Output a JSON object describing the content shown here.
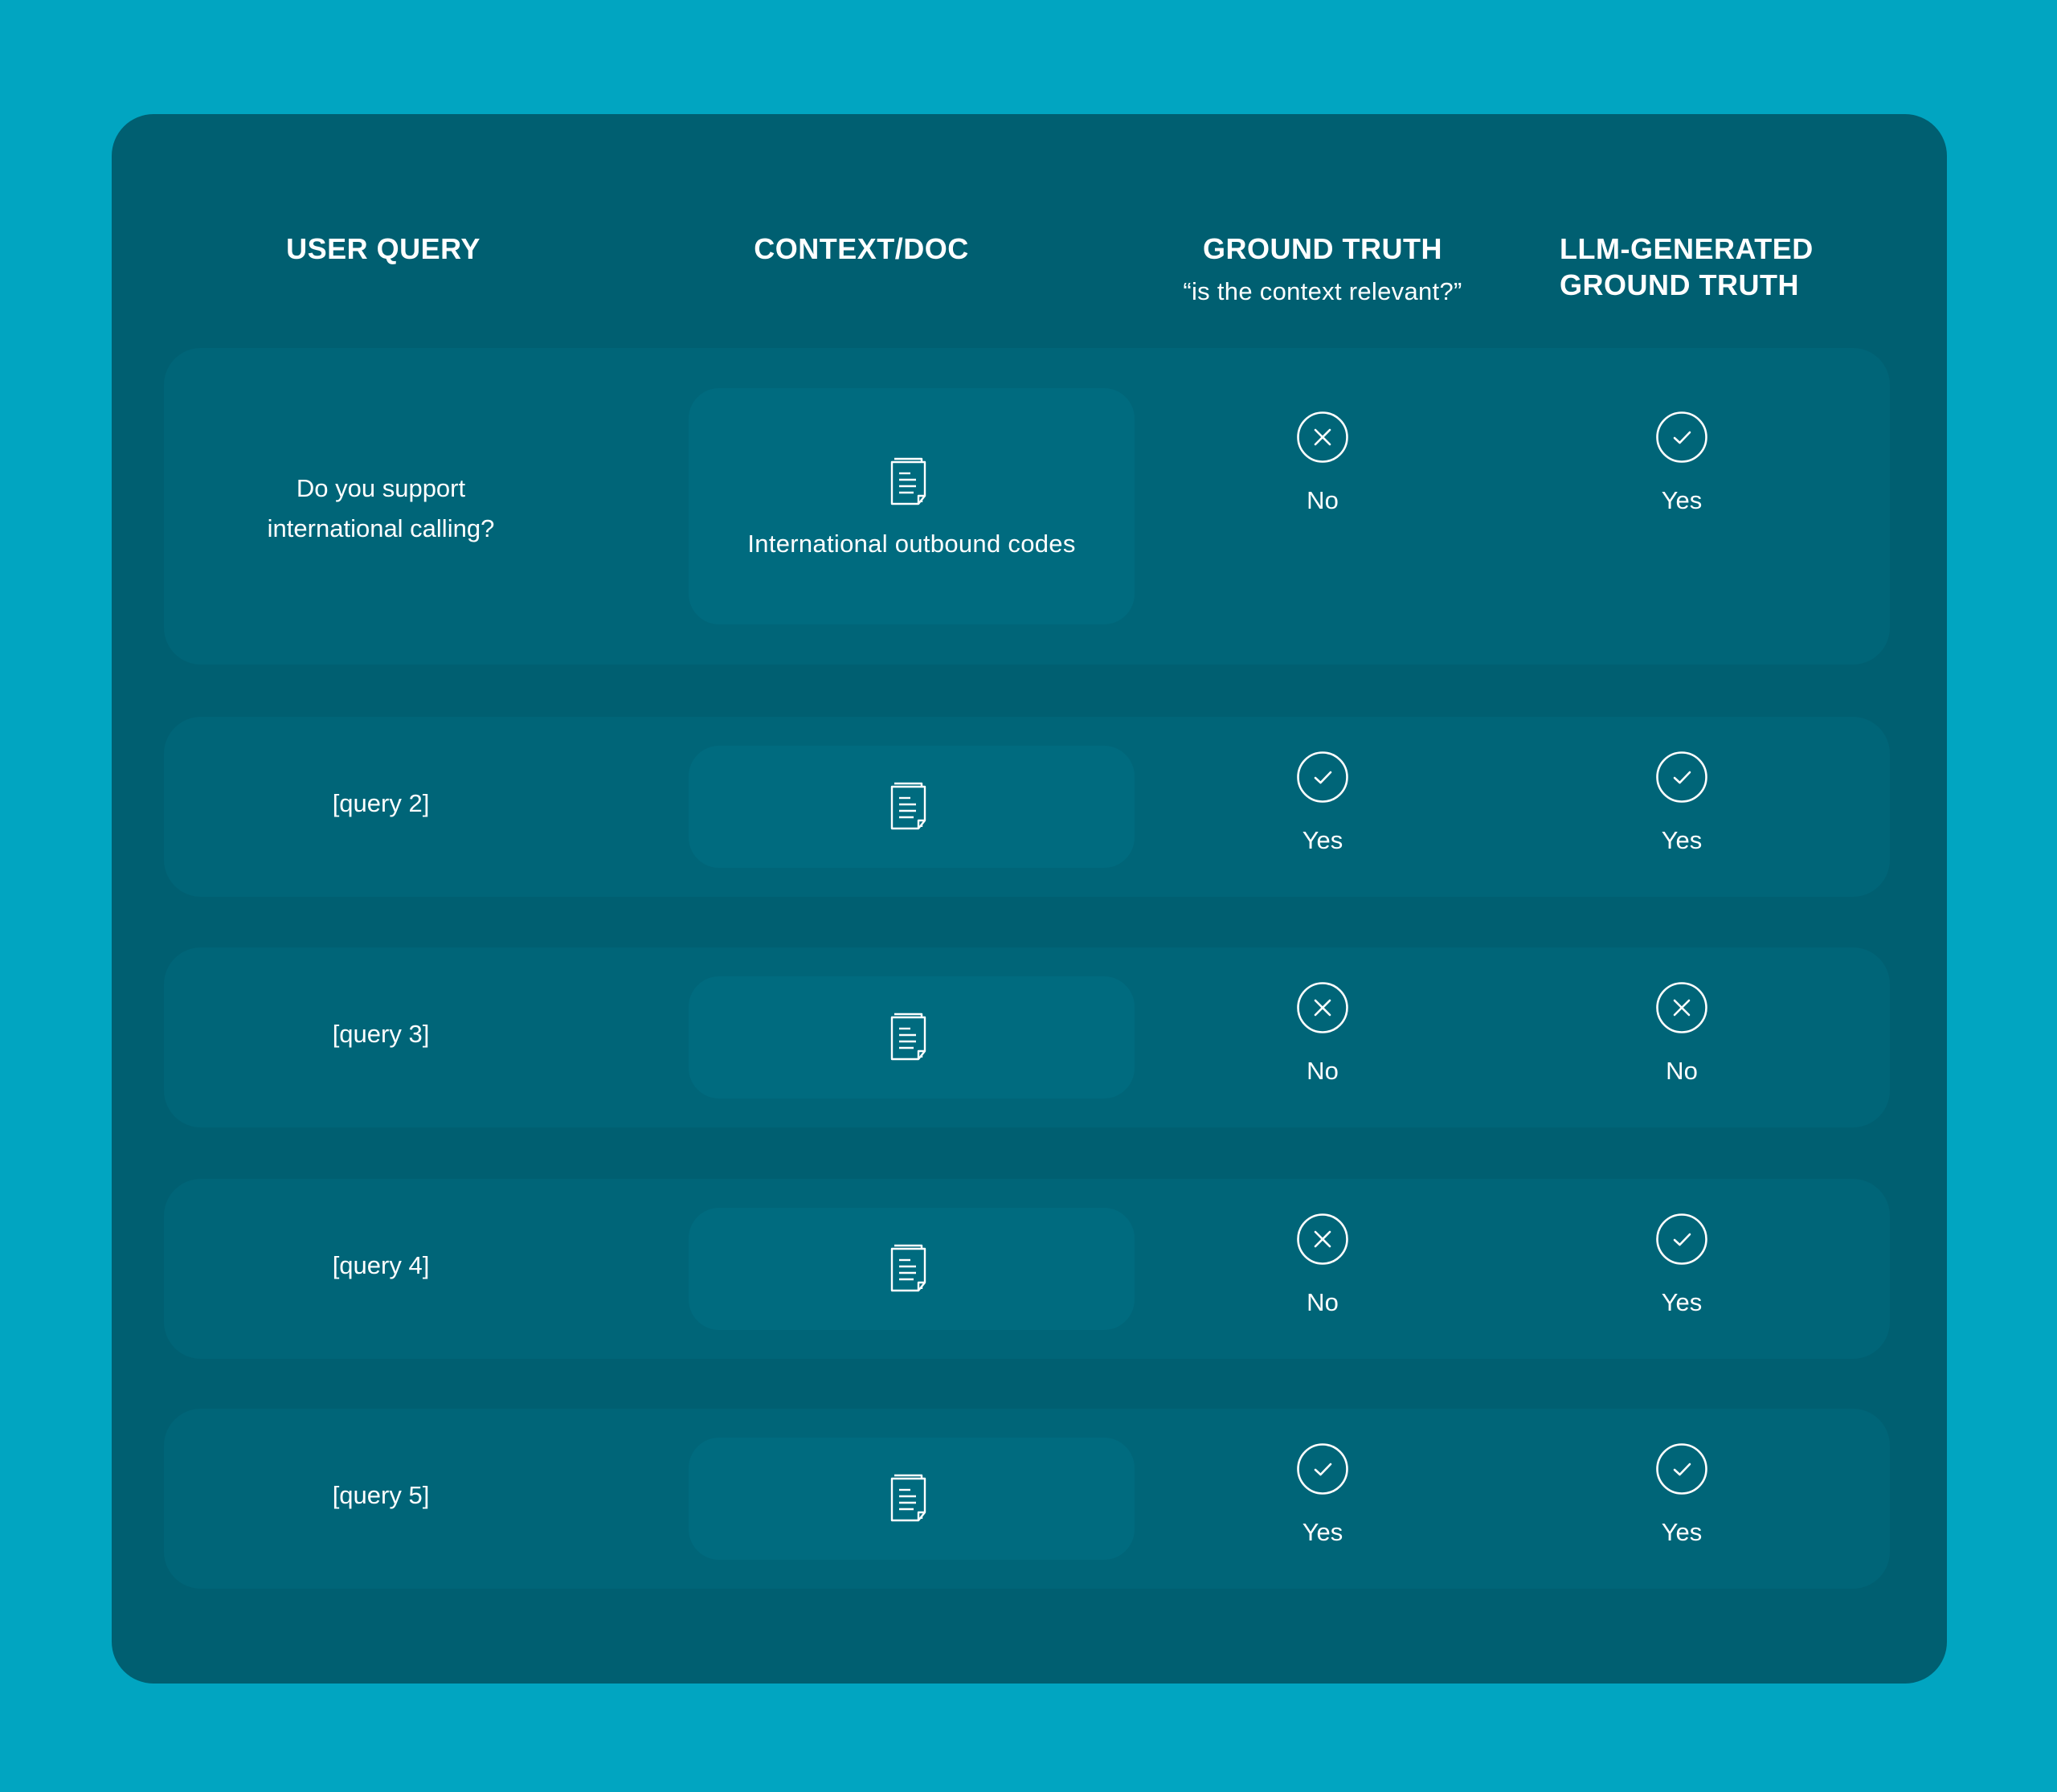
{
  "headers": {
    "user_query": "USER QUERY",
    "context_doc": "CONTEXT/DOC",
    "ground_truth": "GROUND TRUTH",
    "ground_truth_sub": "“is the context relevant?”",
    "llm_line1": "LLM-GENERATED",
    "llm_line2": "GROUND TRUTH"
  },
  "rows": [
    {
      "query_line1": "Do you support",
      "query_line2": "international calling?",
      "context": "International outbound codes",
      "ground_truth": "No",
      "ground_truth_icon": "x-circle-icon",
      "llm": "Yes",
      "llm_icon": "check-circle-icon"
    },
    {
      "query_line1": "[query 2]",
      "context": "",
      "ground_truth": "Yes",
      "ground_truth_icon": "check-circle-icon",
      "llm": "Yes",
      "llm_icon": "check-circle-icon"
    },
    {
      "query_line1": "[query 3]",
      "context": "",
      "ground_truth": "No",
      "ground_truth_icon": "x-circle-icon",
      "llm": "No",
      "llm_icon": "x-circle-icon"
    },
    {
      "query_line1": "[query 4]",
      "context": "",
      "ground_truth": "No",
      "ground_truth_icon": "x-circle-icon",
      "llm": "Yes",
      "llm_icon": "check-circle-icon"
    },
    {
      "query_line1": "[query 5]",
      "context": "",
      "ground_truth": "Yes",
      "ground_truth_icon": "check-circle-icon",
      "llm": "Yes",
      "llm_icon": "check-circle-icon"
    }
  ],
  "colors": {
    "background": "#01a5c1",
    "panel": "#005f71",
    "row": "#006578",
    "context_box": "#006b7f",
    "text": "#ffffff"
  }
}
